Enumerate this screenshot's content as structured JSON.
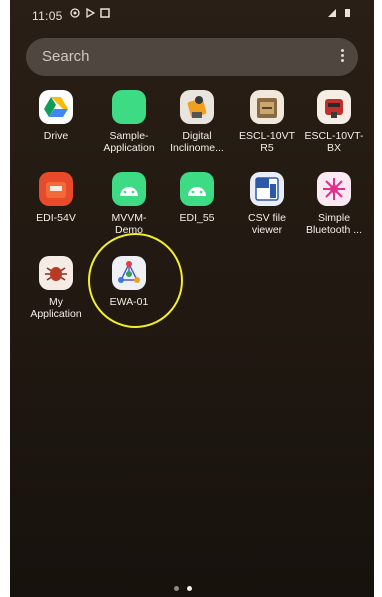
{
  "status_bar": {
    "time": "11:05"
  },
  "search": {
    "placeholder": "Search"
  },
  "apps": [
    {
      "label": "Drive"
    },
    {
      "label": "Sample-\nApplication"
    },
    {
      "label": "Digital\nInclinome..."
    },
    {
      "label": "ESCL-10VT\nR5"
    },
    {
      "label": "ESCL-10VT-\nBX"
    },
    {
      "label": "EDI-54V"
    },
    {
      "label": "MVVM-\nDemo"
    },
    {
      "label": "EDI_55"
    },
    {
      "label": "CSV file\nviewer"
    },
    {
      "label": "Simple\nBluetooth ..."
    },
    {
      "label": "My\nApplication"
    },
    {
      "label": "EWA-01"
    }
  ],
  "pager": {
    "pages": 2,
    "active_index": 1
  },
  "colors": {
    "highlight": "#f2ee2a",
    "android_green": "#3ddc84"
  }
}
